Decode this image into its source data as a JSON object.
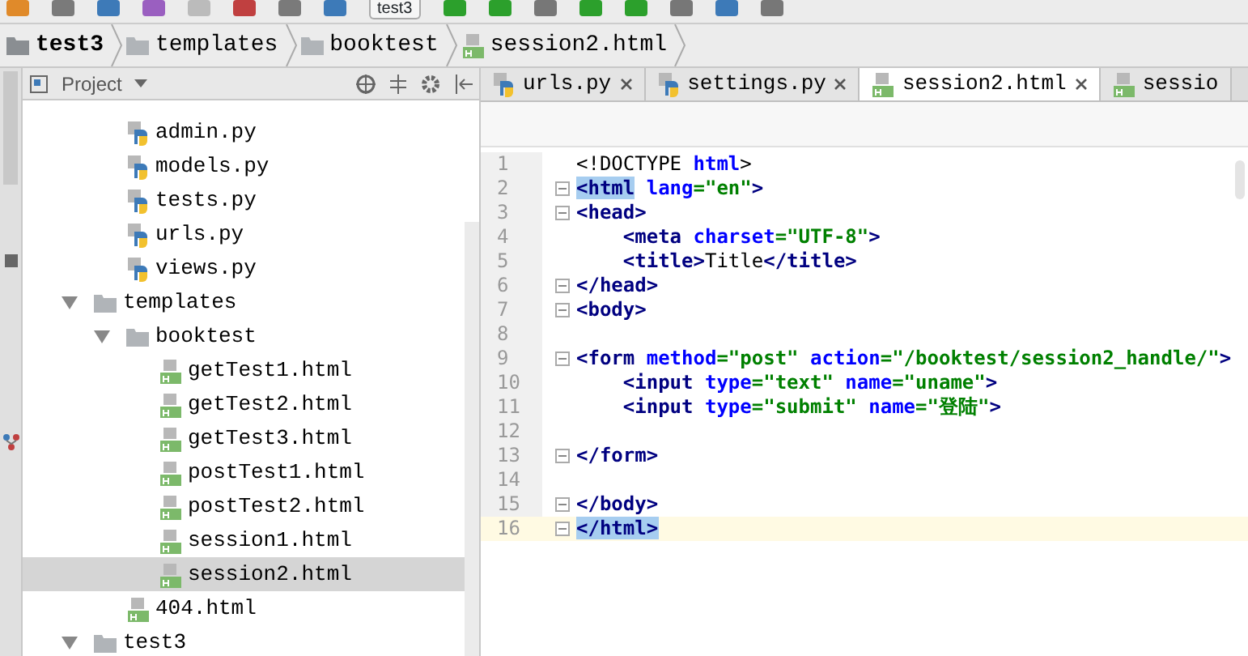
{
  "toolbar": {
    "run_config": "test3"
  },
  "breadcrumbs": [
    {
      "label": "test3",
      "kind": "project"
    },
    {
      "label": "templates",
      "kind": "folder"
    },
    {
      "label": "booktest",
      "kind": "folder"
    },
    {
      "label": "session2.html",
      "kind": "html"
    }
  ],
  "project_panel": {
    "title": "Project",
    "tree": [
      {
        "label": "admin.py",
        "kind": "py",
        "selected": false
      },
      {
        "label": "models.py",
        "kind": "py",
        "selected": false
      },
      {
        "label": "tests.py",
        "kind": "py",
        "selected": false
      },
      {
        "label": "urls.py",
        "kind": "py",
        "selected": false
      },
      {
        "label": "views.py",
        "kind": "py",
        "selected": false
      },
      {
        "label": "templates",
        "kind": "folder",
        "selected": false,
        "expanded": true,
        "children": [
          {
            "label": "booktest",
            "kind": "folder",
            "selected": false,
            "expanded": true,
            "children": [
              {
                "label": "getTest1.html",
                "kind": "html",
                "selected": false
              },
              {
                "label": "getTest2.html",
                "kind": "html",
                "selected": false
              },
              {
                "label": "getTest3.html",
                "kind": "html",
                "selected": false
              },
              {
                "label": "postTest1.html",
                "kind": "html",
                "selected": false
              },
              {
                "label": "postTest2.html",
                "kind": "html",
                "selected": false
              },
              {
                "label": "session1.html",
                "kind": "html",
                "selected": false
              },
              {
                "label": "session2.html",
                "kind": "html",
                "selected": true
              }
            ]
          },
          {
            "label": "404.html",
            "kind": "html",
            "selected": false
          }
        ]
      },
      {
        "label": "test3",
        "kind": "folder",
        "selected": false,
        "expanded": true
      }
    ]
  },
  "tabs": [
    {
      "label": "urls.py",
      "kind": "py",
      "selected": false,
      "closable": true
    },
    {
      "label": "settings.py",
      "kind": "py",
      "selected": false,
      "closable": true
    },
    {
      "label": "session2.html",
      "kind": "html",
      "selected": true,
      "closable": true
    },
    {
      "label": "sessio",
      "kind": "html",
      "selected": false,
      "closable": false
    }
  ],
  "editor": {
    "lines": [
      {
        "number": "1",
        "fold": false,
        "current": false,
        "segments": [
          {
            "text": "<!DOCTYPE",
            "kind": "text"
          },
          {
            "text": " html",
            "kind": "attr"
          },
          {
            "text": ">",
            "kind": "text"
          }
        ]
      },
      {
        "number": "2",
        "fold": true,
        "current": false,
        "segments": [
          {
            "text": "<html",
            "kind": "tag",
            "matched": true
          },
          {
            "text": " lang",
            "kind": "attr"
          },
          {
            "text": "=\"en\"",
            "kind": "value"
          },
          {
            "text": ">",
            "kind": "tag"
          }
        ]
      },
      {
        "number": "3",
        "fold": true,
        "current": false,
        "segments": [
          {
            "text": "<head>",
            "kind": "tag"
          }
        ]
      },
      {
        "number": "4",
        "fold": false,
        "current": false,
        "segments": [
          {
            "text": "    <meta",
            "kind": "tag"
          },
          {
            "text": " charset",
            "kind": "attr"
          },
          {
            "text": "=\"UTF-8\"",
            "kind": "value"
          },
          {
            "text": ">",
            "kind": "tag"
          }
        ]
      },
      {
        "number": "5",
        "fold": false,
        "current": false,
        "segments": [
          {
            "text": "    <title>",
            "kind": "tag"
          },
          {
            "text": "Title",
            "kind": "text"
          },
          {
            "text": "</title>",
            "kind": "tag"
          }
        ]
      },
      {
        "number": "6",
        "fold": true,
        "current": false,
        "segments": [
          {
            "text": "</head>",
            "kind": "tag"
          }
        ]
      },
      {
        "number": "7",
        "fold": true,
        "current": false,
        "segments": [
          {
            "text": "<body>",
            "kind": "tag"
          }
        ]
      },
      {
        "number": "8",
        "fold": false,
        "current": false
      },
      {
        "number": "9",
        "fold": true,
        "current": false,
        "segments": [
          {
            "text": "<form",
            "kind": "tag"
          },
          {
            "text": " method",
            "kind": "attr"
          },
          {
            "text": "=\"post\"",
            "kind": "value"
          },
          {
            "text": " action",
            "kind": "attr"
          },
          {
            "text": "=\"/booktest/session2_handle/\"",
            "kind": "value"
          },
          {
            "text": ">",
            "kind": "tag"
          }
        ]
      },
      {
        "number": "10",
        "fold": false,
        "current": false,
        "segments": [
          {
            "text": "    <input",
            "kind": "tag"
          },
          {
            "text": " type",
            "kind": "attr"
          },
          {
            "text": "=\"text\"",
            "kind": "value"
          },
          {
            "text": " name",
            "kind": "attr"
          },
          {
            "text": "=\"uname\"",
            "kind": "value"
          },
          {
            "text": ">",
            "kind": "tag"
          }
        ]
      },
      {
        "number": "11",
        "fold": false,
        "current": false,
        "segments": [
          {
            "text": "    <input",
            "kind": "tag"
          },
          {
            "text": " type",
            "kind": "attr"
          },
          {
            "text": "=\"submit\"",
            "kind": "value"
          },
          {
            "text": " name",
            "kind": "attr"
          },
          {
            "text": "=\"登陆\"",
            "kind": "value"
          },
          {
            "text": ">",
            "kind": "tag"
          }
        ]
      },
      {
        "number": "12",
        "fold": false,
        "current": false
      },
      {
        "number": "13",
        "fold": true,
        "current": false,
        "segments": [
          {
            "text": "</form>",
            "kind": "tag"
          }
        ]
      },
      {
        "number": "14",
        "fold": false,
        "current": false
      },
      {
        "number": "15",
        "fold": true,
        "current": false,
        "segments": [
          {
            "text": "</body>",
            "kind": "tag"
          }
        ]
      },
      {
        "number": "16",
        "fold": true,
        "current": true,
        "segments": [
          {
            "text": "</html>",
            "kind": "tag",
            "matched": true
          }
        ]
      }
    ]
  }
}
